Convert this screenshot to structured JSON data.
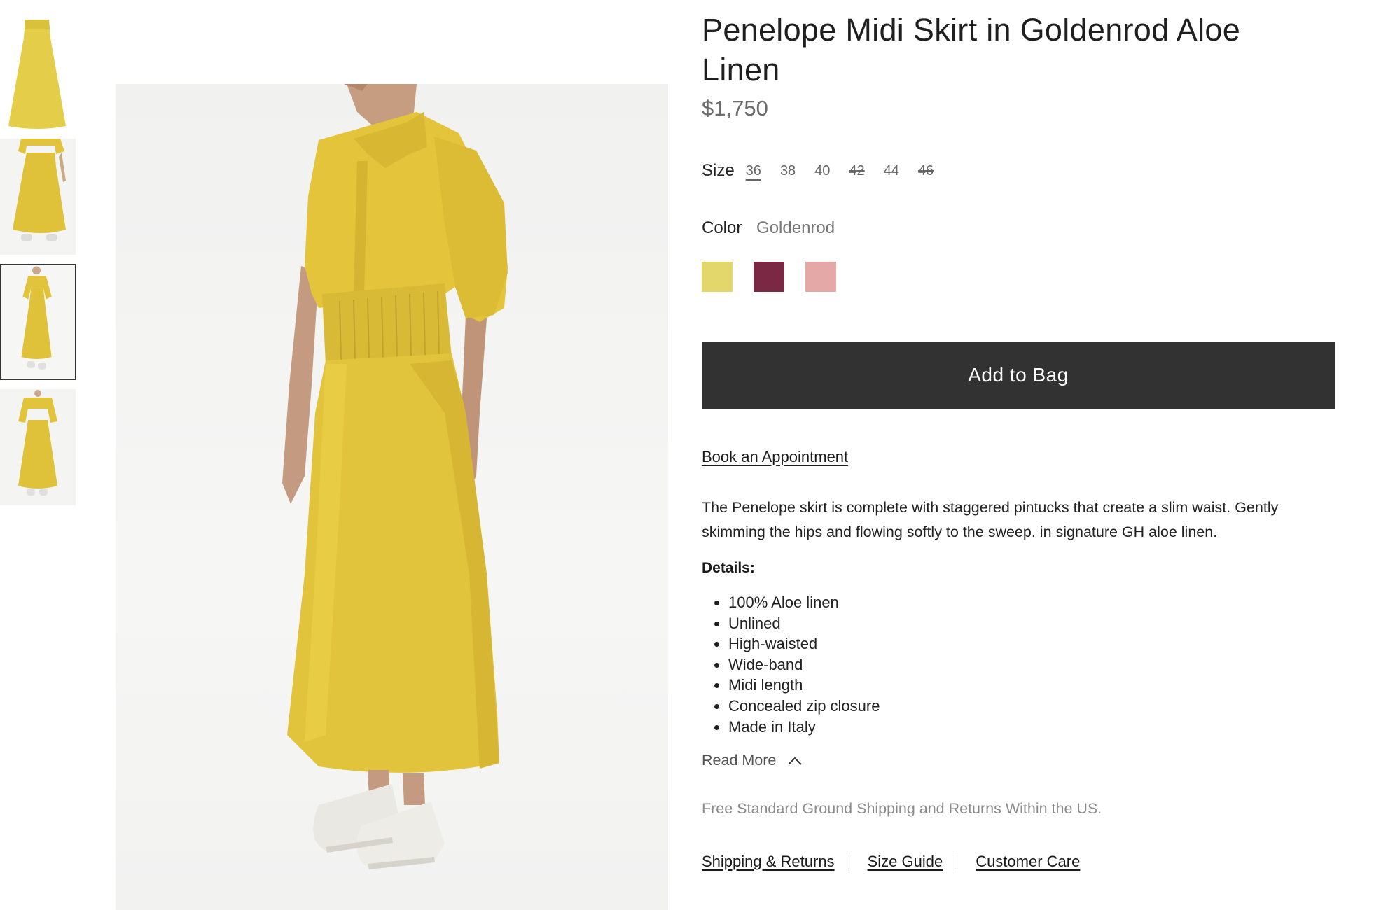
{
  "gallery": {
    "thumbnails": [
      {
        "view": "skirt-front-flat"
      },
      {
        "view": "outfit-side-cropped"
      },
      {
        "view": "outfit-side-full"
      },
      {
        "view": "outfit-front-full"
      }
    ],
    "selected_index": 2
  },
  "product": {
    "title": "Penelope Midi Skirt in Goldenrod Aloe Linen",
    "price": "$1,750"
  },
  "size": {
    "label": "Size",
    "options": [
      {
        "value": "36",
        "available": true,
        "selected": true
      },
      {
        "value": "38",
        "available": true,
        "selected": false
      },
      {
        "value": "40",
        "available": true,
        "selected": false
      },
      {
        "value": "42",
        "available": false,
        "selected": false
      },
      {
        "value": "44",
        "available": true,
        "selected": false
      },
      {
        "value": "46",
        "available": false,
        "selected": false
      }
    ]
  },
  "color": {
    "label": "Color",
    "selected": "Goldenrod",
    "swatches": [
      {
        "hex": "#e3d66a"
      },
      {
        "hex": "#7a2844"
      },
      {
        "hex": "#e4a8a6"
      }
    ]
  },
  "actions": {
    "add_to_bag": "Add to Bag",
    "book_appointment": "Book an Appointment"
  },
  "description": "The Penelope skirt is complete with staggered pintucks that create a slim waist. Gently skimming the hips and flowing softly to the sweep. in signature GH aloe linen.",
  "details": {
    "title": "Details:",
    "items": [
      "100% Aloe linen",
      "Unlined",
      "High-waisted",
      "Wide-band",
      "Midi length",
      "Concealed zip closure",
      "Made in Italy"
    ]
  },
  "read_more": {
    "label": "Read More",
    "icon": "chevron-up-icon"
  },
  "shipping_note": "Free Standard Ground Shipping and Returns Within the US.",
  "footer_links": [
    "Shipping & Returns",
    "Size Guide",
    "Customer Care"
  ],
  "colors": {
    "button_bg": "#323232",
    "garment": "#e1c63c",
    "text_muted": "#8a8a8a"
  }
}
